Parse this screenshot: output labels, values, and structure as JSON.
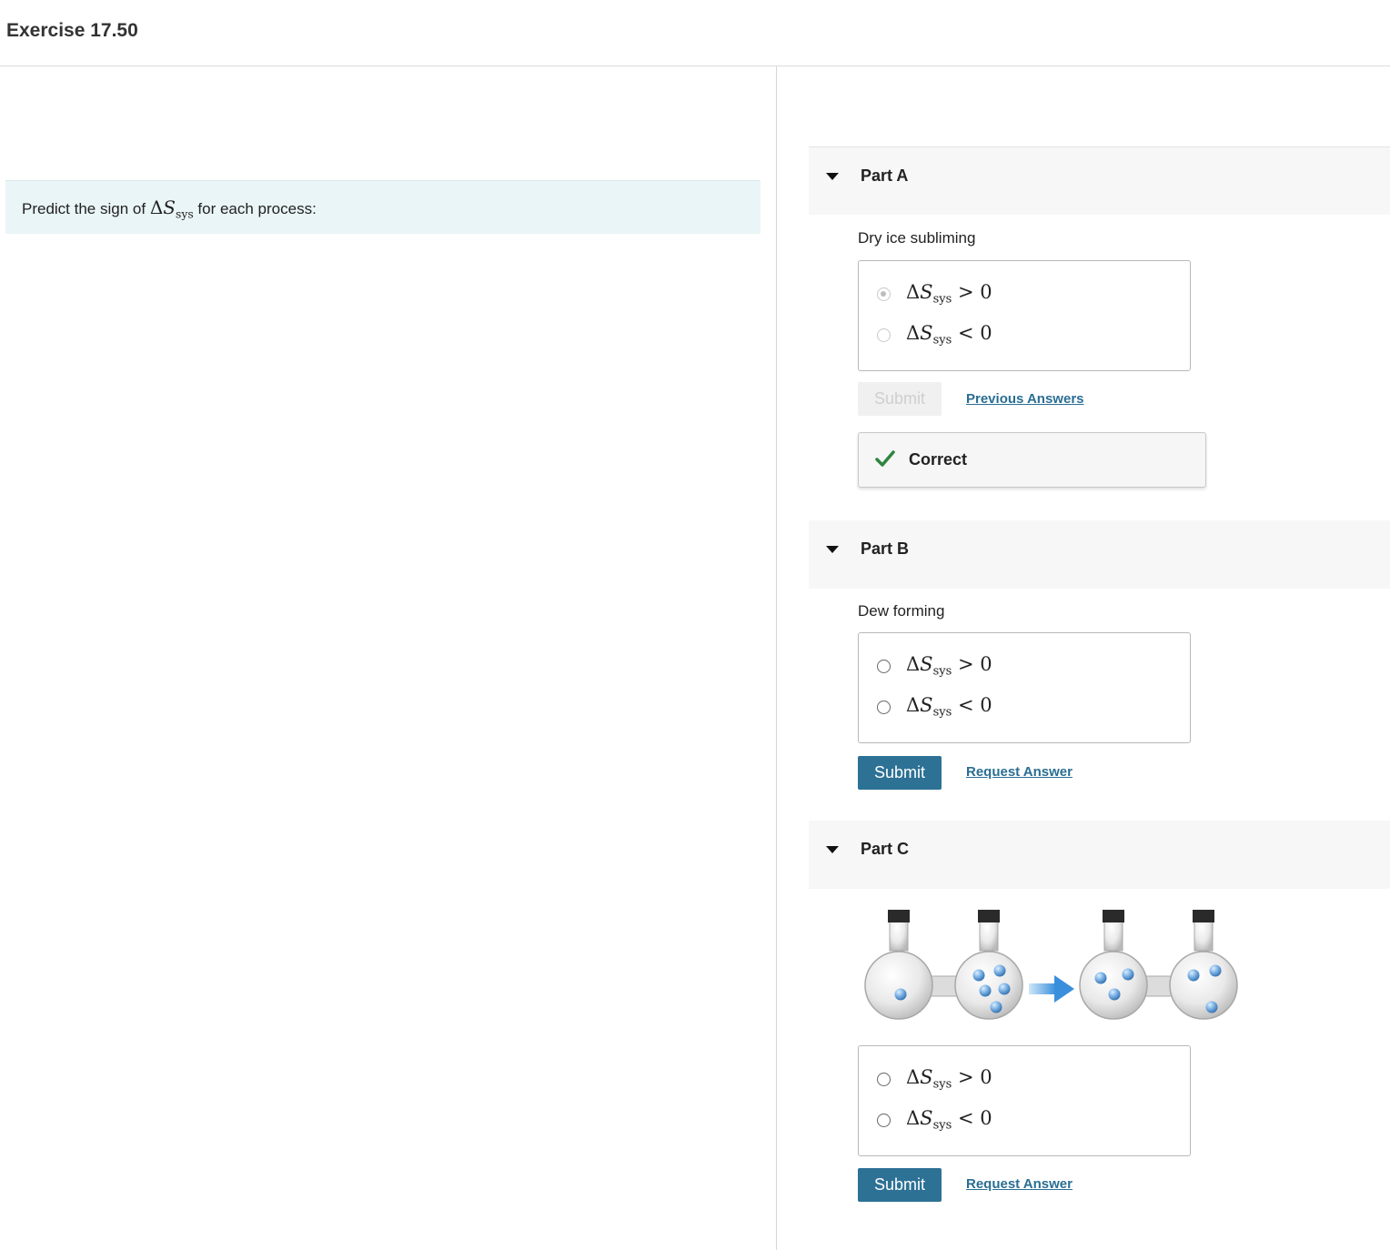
{
  "header": {
    "title": "Exercise 17.50"
  },
  "intro": {
    "before": "Predict the sign of ",
    "delta": "Δ",
    "symbol": "S",
    "sub": "sys",
    "after": " for each process:"
  },
  "choices": {
    "positive": {
      "delta": "Δ",
      "symbol": "S",
      "sub": "sys",
      "relation": " > 0"
    },
    "negative": {
      "delta": "Δ",
      "symbol": "S",
      "sub": "sys",
      "relation": " < 0"
    }
  },
  "parts": [
    {
      "title": "Part A",
      "question": "Dry ice subliming",
      "selected": "positive",
      "submit_label": "Submit",
      "submit_enabled": false,
      "link_label": "Previous Answers",
      "feedback": "Correct"
    },
    {
      "title": "Part B",
      "question": "Dew forming",
      "selected": null,
      "submit_label": "Submit",
      "submit_enabled": true,
      "link_label": "Request Answer"
    },
    {
      "title": "Part C",
      "figure": "two-connected-flasks-gas-expansion",
      "selected": null,
      "submit_label": "Submit",
      "submit_enabled": true,
      "link_label": "Request Answer"
    }
  ],
  "colors": {
    "primary_button": "#2d7195",
    "link": "#2a6e93",
    "correct_check": "#2e8540",
    "intro_bg": "#eaf5f7"
  },
  "icons": {
    "collapse": "caret-down-icon",
    "correct": "checkmark-icon",
    "arrow": "right-arrow-icon"
  }
}
